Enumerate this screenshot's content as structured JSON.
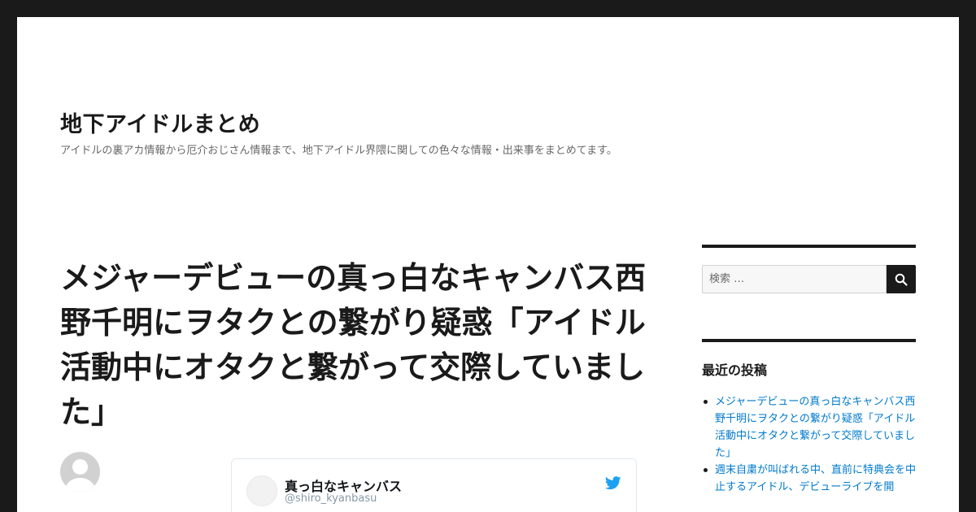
{
  "site": {
    "title": "地下アイドルまとめ",
    "description": "アイドルの裏アカ情報から厄介おじさん情報まで、地下アイドル界隈に関しての色々な情報・出来事をまとめてます。"
  },
  "post": {
    "title": "メジャーデビューの真っ白なキャンバス西野千明にヲタクとの繋がり疑惑「アイドル活動中にオタクと繋がって交際していました」"
  },
  "tweet": {
    "name": "真っ白なキャンバス",
    "handle": "@shiro_kyanbasu",
    "icon": "twitter-bird-icon"
  },
  "sidebar": {
    "search": {
      "placeholder": "検索 …",
      "icon": "search-icon"
    },
    "recent_posts": {
      "title": "最近の投稿",
      "items": [
        {
          "label": "メジャーデビューの真っ白なキャンバス西野千明にヲタクとの繋がり疑惑「アイドル活動中にオタクと繋がって交際していました」"
        },
        {
          "label": "週末自粛が叫ばれる中、直前に特典会を中止するアイドル、デビューライブを開"
        }
      ]
    }
  },
  "colors": {
    "frame": "#1a1a1a",
    "page": "#ffffff",
    "link": "#007acc",
    "twitter": "#1da1f2"
  }
}
